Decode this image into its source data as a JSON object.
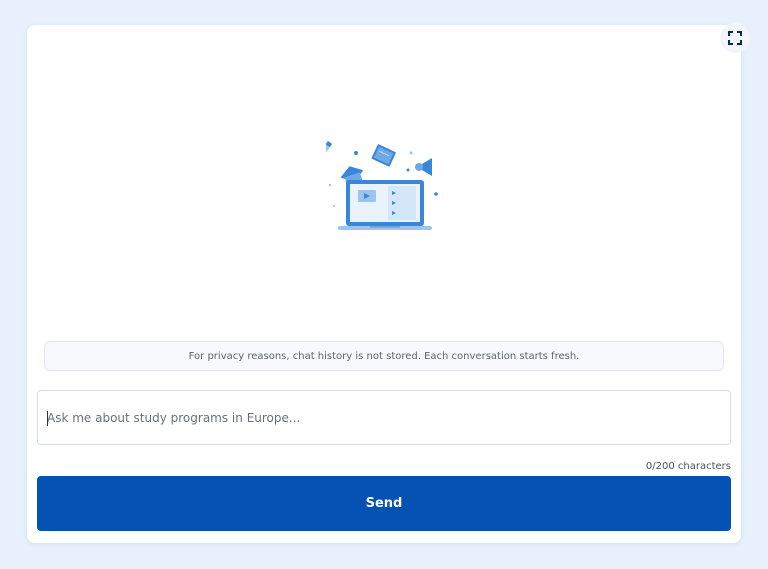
{
  "chat": {
    "notice": "For privacy reasons, chat history is not stored. Each conversation starts fresh.",
    "input_value": "",
    "input_placeholder": "Ask me about study programs in Europe...",
    "char_count": "0/200 characters",
    "send_label": "Send"
  },
  "icons": {
    "fullscreen": "expand-icon",
    "illustration": "online-learning-illustration"
  },
  "colors": {
    "page_background": "#e7f0fb",
    "card_background": "#ffffff",
    "primary": "#0452b3",
    "illustration_blue": "#3a86d9",
    "illustration_light": "#b9d8f5"
  }
}
